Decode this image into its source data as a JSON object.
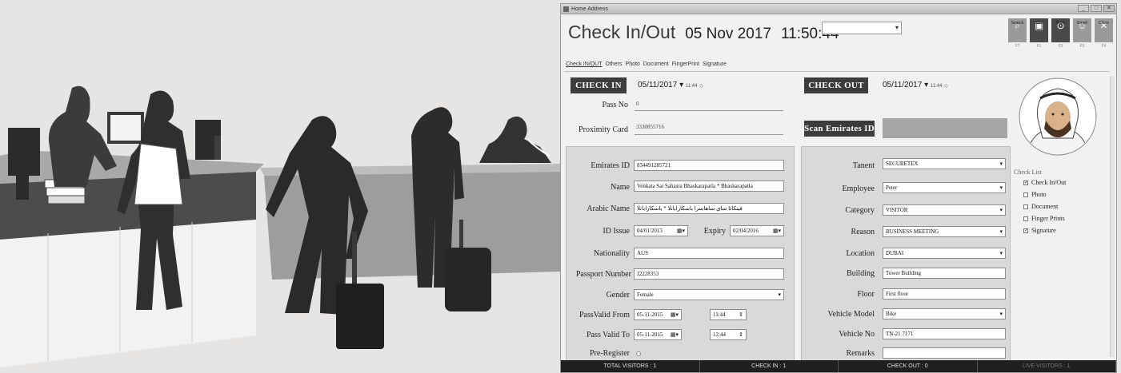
{
  "window": {
    "title": "Home Address",
    "controls": [
      "_",
      "□",
      "✕"
    ]
  },
  "header": {
    "title": "Check In/Out",
    "date": "05 Nov 2017",
    "time": "11:50:44",
    "dropdown_value": ""
  },
  "toolbar": [
    {
      "label": "Search",
      "icon": "search-icon",
      "glyph": "⌕",
      "key": "F7"
    },
    {
      "label": "Save",
      "icon": "save-icon",
      "glyph": "▣",
      "key": "F1"
    },
    {
      "label": "Back",
      "icon": "back-icon",
      "glyph": "⊙",
      "key": "F3"
    },
    {
      "label": "Email",
      "icon": "email-icon",
      "glyph": "☺",
      "key": "F5"
    },
    {
      "label": "Close",
      "icon": "close-icon",
      "glyph": "✕",
      "key": "F4"
    }
  ],
  "tabs": [
    "Check IN/OUT",
    "Others",
    "Photo",
    "Document",
    "FingerPrint",
    "Signature"
  ],
  "checkin": {
    "button": "CHECK IN",
    "date": "05/11/2017",
    "time": "11:44"
  },
  "checkout": {
    "button": "CHECK OUT",
    "date": "05/11/2017",
    "time": "11:44"
  },
  "pass_no": {
    "label": "Pass No",
    "value": "0"
  },
  "proximity": {
    "label": "Proximity Card",
    "value": "3330855716"
  },
  "scan_button": "Scan Emirates ID",
  "left_form": {
    "emirates_id": {
      "label": "Emirates ID",
      "value": "834491285721"
    },
    "name": {
      "label": "Name",
      "value": "Venkata Sai Sahasra Bhaskarapatla * Bhaskarapatla"
    },
    "arabic_name": {
      "label": "Arabic Name",
      "value": "ﻓﻴﻨﻜﺎﺗﺎ ﺳﺎي ﺳﺎﻫﺎﺳﺮا ﺑﺎﺳﻜﺎراﺑﺎﺗﻼ * ﺑﺎﺳﻜﺎراﺑﺎﺗﻼ"
    },
    "id_issue": {
      "label": "ID Issue",
      "value": "04/01/2013"
    },
    "expiry": {
      "label": "Expiry",
      "value": "02/04/2016"
    },
    "nationality": {
      "label": "Nationality",
      "value": "AUS"
    },
    "passport": {
      "label": "Passport Number",
      "value": "J2228353"
    },
    "gender": {
      "label": "Gender",
      "value": "Female"
    },
    "pass_valid_from": {
      "label": "PassValid From",
      "date": "05-11-2015",
      "time": "11:44"
    },
    "pass_valid_to": {
      "label": "Pass Valid To",
      "date": "05-11-2015",
      "time": "12:44"
    },
    "pre_register": {
      "label": "Pre-Register"
    }
  },
  "right_form": {
    "tenant": {
      "label": "Tanent",
      "value": "SECURETEX"
    },
    "employee": {
      "label": "Employee",
      "value": "Peter"
    },
    "category": {
      "label": "Category",
      "value": "VISITOR"
    },
    "reason": {
      "label": "Reason",
      "value": "BUSINESS MEETING"
    },
    "location": {
      "label": "Location",
      "value": "DUBAI"
    },
    "building": {
      "label": "Building",
      "value": "Tower Building"
    },
    "floor": {
      "label": "Floor",
      "value": "First floor"
    },
    "vehicle_model": {
      "label": "Vehicle Model",
      "value": "Bike"
    },
    "vehicle_no": {
      "label": "Vehicle No",
      "value": "TN-21 7171"
    },
    "remarks": {
      "label": "Remarks",
      "value": ""
    }
  },
  "checklist": {
    "title": "Check List",
    "items": [
      {
        "label": "Check In/Out",
        "checked": true
      },
      {
        "label": "Photo",
        "checked": false
      },
      {
        "label": "Document",
        "checked": false
      },
      {
        "label": "Finger Prints",
        "checked": false
      },
      {
        "label": "Signature",
        "checked": true
      }
    ]
  },
  "status": {
    "total": "TOTAL VISITORS : 1",
    "checkin": "CHECK IN : 1",
    "checkout": "CHECK OUT : 0",
    "live": "LIVE VISITORS : 1"
  },
  "colors": {
    "dark": "#3c3c3c",
    "panel": "#d9d9d9",
    "status": "#1f1f1f"
  }
}
